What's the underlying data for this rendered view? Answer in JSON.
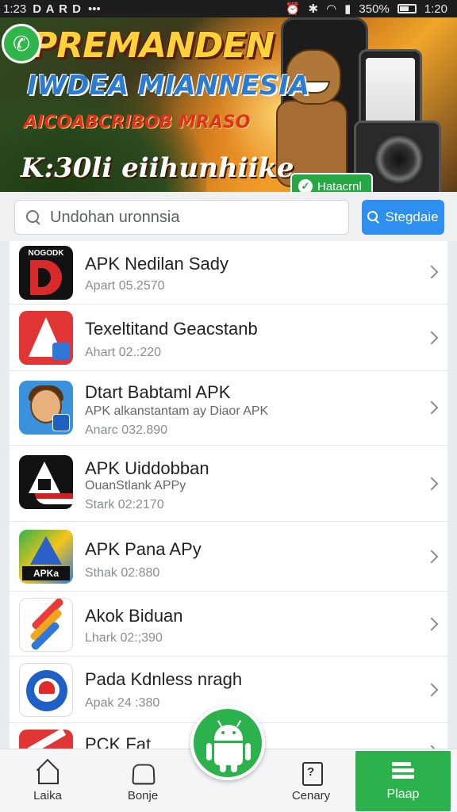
{
  "status_bar": {
    "time_left": "1:23",
    "notification_letters": "D A R D",
    "overflow": "•••",
    "battery": "350%",
    "clock": "1:20"
  },
  "banner": {
    "title": "PREMANDEN",
    "subtitle": "IWDEA MIANNESIA",
    "tagline": "AICOABCRIBOB MRASO",
    "footer": "K:30li eiihunhiike",
    "badge_label": "Hatacrnl",
    "icons": [
      "phone-call-icon",
      "check-icon"
    ]
  },
  "search": {
    "placeholder": "Undohan uronnsia",
    "button_label": "Stegdaie"
  },
  "apps": [
    {
      "name": "APK Nedilan Sady",
      "sub": "",
      "meta": "Apart 05.2570",
      "icon": "brand-d-icon",
      "icon_text": "NOGODK"
    },
    {
      "name": "Texeltitand Geacstanb",
      "sub": "",
      "meta": "Ahart 02.:220",
      "icon": "brand-a-icon"
    },
    {
      "name": "Dtart Babtaml APK",
      "sub": "APK alkanstantam ay Diaor APK",
      "meta": "Anarc 032.890",
      "icon": "avatar-boy-icon"
    },
    {
      "name": "APK Uiddobban",
      "sub": "OuanStlank APPy",
      "meta": "Stark 02:2170",
      "icon": "brand-flag-icon"
    },
    {
      "name": "APK Pana APy",
      "sub": "",
      "meta": "Sthak 02:880",
      "icon": "brand-apk-icon",
      "icon_text": "APKa"
    },
    {
      "name": "Akok Biduan",
      "sub": "",
      "meta": "Lhark 02:;390",
      "icon": "stripes-icon"
    },
    {
      "name": "Pada Kdnless nragh",
      "sub": "",
      "meta": "Apak 24 :380",
      "icon": "round-chat-icon"
    },
    {
      "name": "PCK Fat",
      "sub": "",
      "meta": "",
      "icon": "brand-red-icon"
    }
  ],
  "bottom_nav": [
    {
      "label": "Laika",
      "icon": "home-icon"
    },
    {
      "label": "Bonje",
      "icon": "shape-icon"
    },
    {
      "label": "Cenary",
      "icon": "doc-question-icon"
    },
    {
      "label": "Plaap",
      "icon": "play-store-icon",
      "active": true
    }
  ],
  "fab": {
    "icon": "android-icon"
  },
  "colors": {
    "accent_green": "#2bb24c",
    "search_blue": "#2f8ff0",
    "banner_gold": "#ffd23a"
  }
}
